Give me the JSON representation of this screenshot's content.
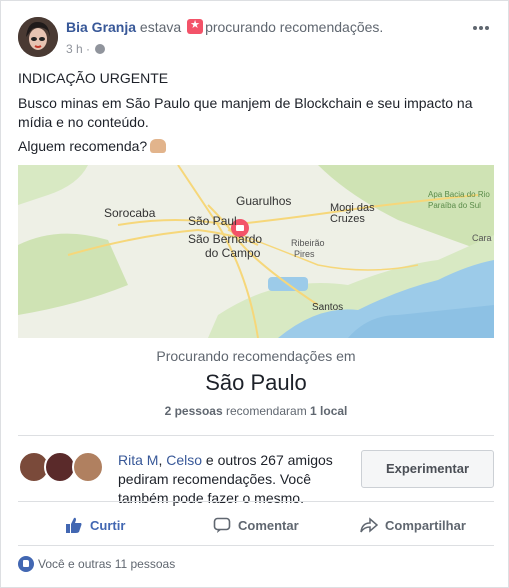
{
  "post": {
    "author": "Bia Granja",
    "verb": "estava",
    "activity": "procurando recomendações.",
    "time": "3 h",
    "dot": " · ",
    "line1": "INDICAÇÃO URGENTE",
    "line2": "Busco minas em São Paulo que manjem de Blockchain e seu impacto na mídia e no conteúdo.",
    "line3": "Alguem recomenda?"
  },
  "map": {
    "cities": {
      "guarulhos": "Guarulhos",
      "sorocaba": "Sorocaba",
      "sao_paulo": "São Paul",
      "sao_bernardo": "São Bernardo",
      "do_campo": "do Campo",
      "mogi": "Mogi das",
      "cruzes": "Cruzes",
      "ribeirao": "Ribeirão",
      "pires": "Pires",
      "santos": "Santos",
      "apa": "Apa Bacia do Rio",
      "paraiba": "Paraíba do Sul",
      "cara": "Cara"
    },
    "colors": {
      "land": "#eef0e6",
      "green": "#cfe3b4",
      "water": "#9ccbe9",
      "road": "#f6d77a",
      "pin": "#f35369"
    }
  },
  "recommendation": {
    "subtitle": "Procurando recomendações em",
    "city": "São Paulo",
    "people_count": "2 pessoas",
    "recommended_text": "recomendaram",
    "places": "1 local"
  },
  "friends": {
    "name1": "Rita M",
    "sep": ", ",
    "name2": "Celso",
    "rest": " e outros 267 amigos pediram recomendações. Você também pode fazer o mesmo.",
    "try_button": "Experimentar"
  },
  "actions": {
    "like": "Curtir",
    "comment": "Comentar",
    "share": "Compartilhar"
  },
  "footer": {
    "likes": "Você e outras 11 pessoas"
  }
}
